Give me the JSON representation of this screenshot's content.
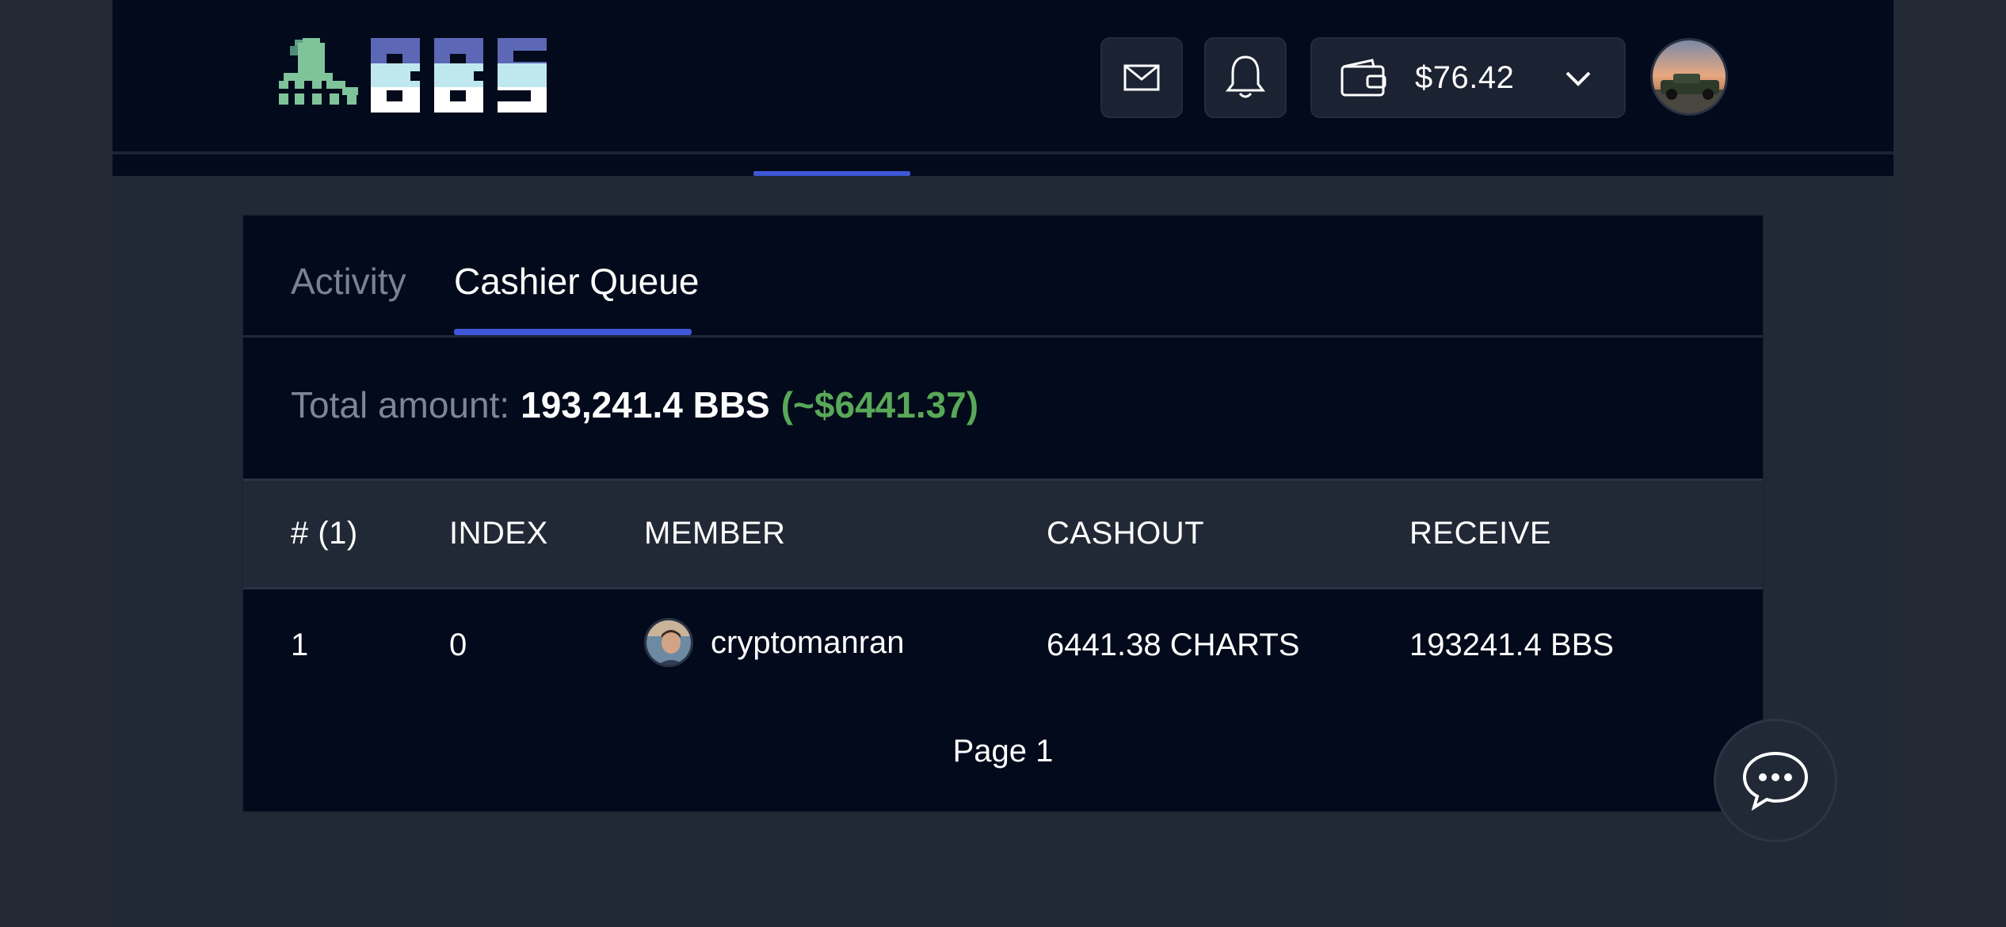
{
  "header": {
    "logo_text": "BBS",
    "wallet": {
      "amount": "$76.42"
    },
    "icons": {
      "mail": "mail-icon",
      "bell": "bell-icon",
      "wallet": "wallet-icon",
      "chevron": "chevron-down-icon",
      "chat": "chat-bubble-icon"
    }
  },
  "tabs": [
    {
      "label": "Activity",
      "active": false
    },
    {
      "label": "Cashier Queue",
      "active": true
    }
  ],
  "summary": {
    "label": "Total amount:",
    "amount_bbs": "193,241.4 BBS",
    "amount_usd": "(~$6441.37)"
  },
  "table": {
    "columns": [
      "# (1)",
      "INDEX",
      "MEMBER",
      "CASHOUT",
      "RECEIVE"
    ],
    "rows": [
      {
        "num": "1",
        "index": "0",
        "member": "cryptomanran",
        "cashout": "6441.38 CHARTS",
        "receive": "193241.4 BBS"
      }
    ]
  },
  "pagination": {
    "label": "Page 1"
  },
  "colors": {
    "accent": "#3f57d8",
    "success": "#58a858",
    "background": "#020a1b",
    "surface": "#222936"
  }
}
